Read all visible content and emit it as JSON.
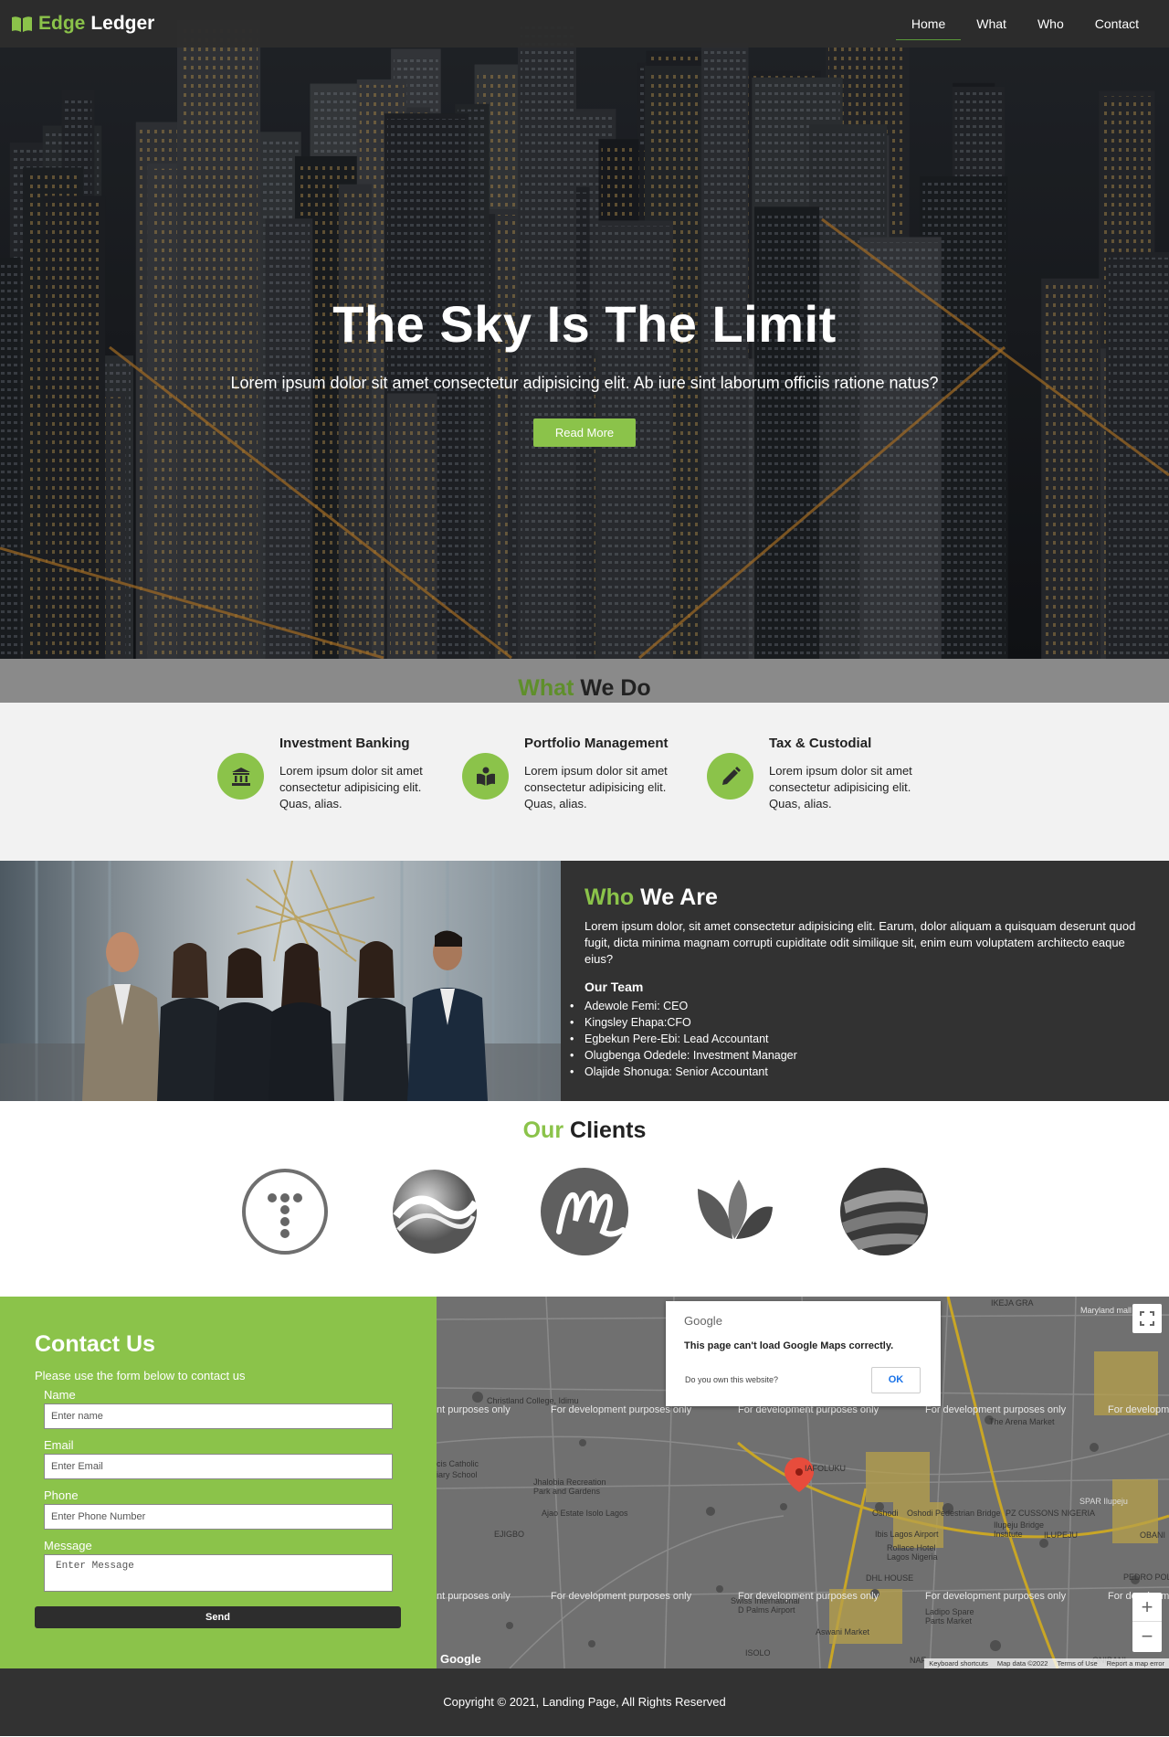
{
  "nav": {
    "brand_green": "Edge",
    "brand_white": "Ledger",
    "items": [
      "Home",
      "What",
      "Who",
      "Contact"
    ],
    "active": "Home"
  },
  "hero": {
    "title": "The Sky Is The Limit",
    "subtitle": "Lorem ipsum dolor sit amet consectetur adipisicing elit. Ab iure sint laborum officiis ratione natus?",
    "button": "Read More"
  },
  "what": {
    "title_green": "What",
    "title_rest": "We Do",
    "services": [
      {
        "title": "Investment Banking",
        "text": "Lorem ipsum dolor sit amet consectetur adipisicing elit. Quas, alias.",
        "icon": "bank-icon"
      },
      {
        "title": "Portfolio Management",
        "text": "Lorem ipsum dolor sit amet consectetur adipisicing elit. Quas, alias.",
        "icon": "book-icon"
      },
      {
        "title": "Tax & Custodial",
        "text": "Lorem ipsum dolor sit amet consectetur adipisicing elit. Quas, alias.",
        "icon": "pencil-icon"
      }
    ]
  },
  "who": {
    "title_green": "Who",
    "title_rest": "We Are",
    "lead": "Lorem ipsum dolor, sit amet consectetur adipisicing elit. Earum, dolor aliquam a quisquam deserunt quod fugit, dicta minima magnam corrupti cupiditate odit similique sit, enim eum voluptatem architecto eaque eius?",
    "team_title": "Our Team",
    "team": [
      "Adewole Femi: CEO",
      "Kingsley Ehapa:CFO",
      "Egbekun Pere-Ebi: Lead Accountant",
      "Olugbenga Odedele: Investment Manager",
      "Olajide Shonuga: Senior Accountant"
    ]
  },
  "clients": {
    "title_green": "Our",
    "title_rest": "Clients"
  },
  "contact": {
    "title": "Contact Us",
    "subtitle": "Please use the form below to contact us",
    "fields": [
      {
        "label": "Name",
        "placeholder": "Enter name"
      },
      {
        "label": "Email",
        "placeholder": "Enter Email"
      },
      {
        "label": "Phone",
        "placeholder": "Enter Phone Number"
      }
    ],
    "message_label": "Message",
    "message_placeholder": "Enter Message",
    "send": "Send"
  },
  "map": {
    "dialog_brand": "Google",
    "dialog_message": "This page can't load Google Maps correctly.",
    "dialog_question": "Do you own this website?",
    "dialog_ok": "OK",
    "watermark": "For development purposes only",
    "watermark_partial": "nt purposes only",
    "labels": [
      "IKEJA GRA",
      "Maryland mall",
      "Christland College, Idimu",
      "The Arena Market",
      "cis Catholic",
      "iary School",
      "IAFOLUKU",
      "Jhalobia Recreation",
      "Park and Gardens",
      "Oshodi",
      "Oshodi Pedestrian Bridge",
      "SPAR Ilupeju",
      "PZ CUSSONS NIGERIA",
      "Ajao Estate Isolo Lagos",
      "Ilupeju Bridge",
      "Institute",
      "EJIGBO",
      "ILUPEJU",
      "OBANI",
      "Ibis Lagos Airport",
      "Rollace Hotel",
      "Lagos Nigeria",
      "DHL HOUSE",
      "PEDRO POLIC",
      "Swiss International",
      "D Palms Airport",
      "Ladipo Spare",
      "Parts Market",
      "Aswani Market",
      "ISOLO",
      "NAF",
      "ONIBANI"
    ],
    "attribution": [
      "Keyboard shortcuts",
      "Map data ©2022",
      "Terms of Use",
      "Report a map error"
    ],
    "logo": "Google"
  },
  "footer": {
    "text": "Copyright © 2021, Landing Page, All Rights Reserved"
  },
  "colors": {
    "accent": "#8bc34a",
    "dark": "#323232",
    "grey_band": "#8a8a8a"
  }
}
